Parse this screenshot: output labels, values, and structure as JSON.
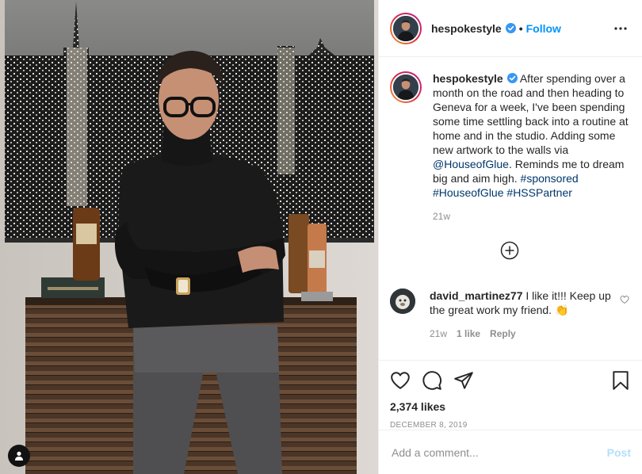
{
  "post": {
    "username": "hespokestyle",
    "follow_label": "Follow",
    "separator": "•",
    "caption": {
      "username": "hespokestyle",
      "text_1": "After spending over a month on the road and then heading to Geneva for a week, I've been spending some time settling back into a routine at home and in the studio. Adding some new artwork to the walls via",
      "mention": "@HouseofGlue",
      "text_2": ". Reminds me to dream big and aim high.",
      "tag_1": "#sponsored",
      "tag_2": "#HouseofGlue",
      "tag_3": "#HSSPartner",
      "time": "21w"
    },
    "comment": {
      "username": "david_martinez77",
      "text": "I like it!!! Keep up the great work my friend. 👏",
      "time": "21w",
      "likes": "1 like",
      "reply_label": "Reply"
    },
    "likes": "2,374 likes",
    "date": "DECEMBER 8, 2019",
    "add_comment_placeholder": "Add a comment...",
    "post_label": "Post"
  },
  "colors": {
    "accent": "#0095f6",
    "text": "#262626",
    "muted": "#8e8e8e",
    "link": "#00376b",
    "post_disabled": "#b2dffc"
  },
  "icons": [
    "user-tag-icon",
    "verified-badge-icon",
    "more-options-icon",
    "load-more-comments-icon",
    "heart-icon",
    "comment-icon",
    "share-icon",
    "save-icon"
  ]
}
